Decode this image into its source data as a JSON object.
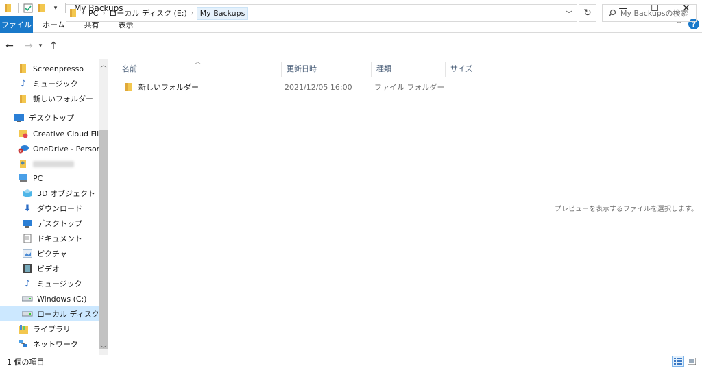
{
  "window": {
    "title": "My Backups",
    "controls": {
      "minimize": "—",
      "maximize": "☐",
      "close": "✕"
    }
  },
  "ribbon": {
    "tabs": [
      "ファイル",
      "ホーム",
      "共有",
      "表示"
    ],
    "collapse_glyph": "﹀",
    "help_glyph": "?"
  },
  "address": {
    "crumbs": [
      "PC",
      "ローカル ディスク (E:)",
      "My Backups"
    ],
    "search_placeholder": "My Backupsの検索"
  },
  "nav_pane": {
    "items": [
      {
        "label": "Screenpresso",
        "icon": "folder-icon",
        "indent": 1
      },
      {
        "label": "ミュージック",
        "icon": "music-icon",
        "indent": 1
      },
      {
        "label": "新しいフォルダー",
        "icon": "folder-icon",
        "indent": 1
      },
      {
        "label": "デスクトップ",
        "icon": "desktop-icon",
        "indent": 0
      },
      {
        "label": "Creative Cloud Files",
        "icon": "creative-cloud-folder-icon",
        "indent": 1
      },
      {
        "label": "OneDrive - Personal",
        "icon": "onedrive-icon",
        "indent": 1
      },
      {
        "label": "",
        "icon": "user-icon",
        "indent": 1
      },
      {
        "label": "PC",
        "icon": "pc-icon",
        "indent": 1
      },
      {
        "label": "3D オブジェクト",
        "icon": "3d-objects-icon",
        "indent": 2
      },
      {
        "label": "ダウンロード",
        "icon": "download-icon",
        "indent": 2
      },
      {
        "label": "デスクトップ",
        "icon": "desktop-icon",
        "indent": 2
      },
      {
        "label": "ドキュメント",
        "icon": "documents-icon",
        "indent": 2
      },
      {
        "label": "ピクチャ",
        "icon": "pictures-icon",
        "indent": 2
      },
      {
        "label": "ビデオ",
        "icon": "video-icon",
        "indent": 2
      },
      {
        "label": "ミュージック",
        "icon": "music-icon",
        "indent": 2
      },
      {
        "label": "Windows (C:)",
        "icon": "drive-icon",
        "indent": 2
      },
      {
        "label": "ローカル ディスク (E:)",
        "icon": "drive-icon",
        "indent": 2,
        "selected": true
      },
      {
        "label": "ライブラリ",
        "icon": "libraries-icon",
        "indent": 1
      },
      {
        "label": "ネットワーク",
        "icon": "network-icon",
        "indent": 1
      }
    ]
  },
  "file_list": {
    "columns": [
      "名前",
      "更新日時",
      "種類",
      "サイズ"
    ],
    "rows": [
      {
        "name": "新しいフォルダー",
        "modified": "2021/12/05 16:00",
        "type": "ファイル フォルダー",
        "size": ""
      }
    ]
  },
  "preview_message": "プレビューを表示するファイルを選択します。",
  "status": {
    "item_count": "1 個の項目"
  },
  "colors": {
    "accent": "#1979ca",
    "folder": "#f3c74f",
    "selection": "#cce8ff"
  }
}
